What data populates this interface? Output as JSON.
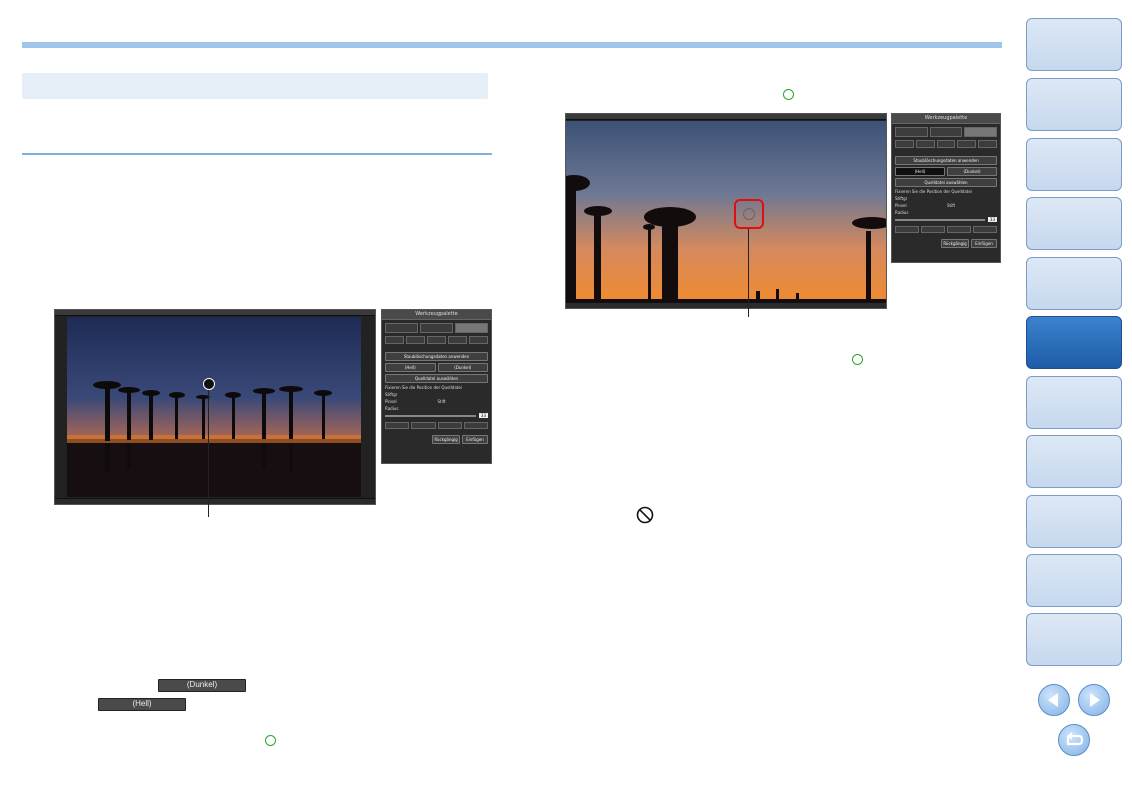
{
  "left_screenshot": {
    "palette": {
      "title": "Werkzeugpalette",
      "btn_apply": "Staublöschungsdaten anwenden",
      "btn_hell": "(Hell)",
      "btn_dunkel": "(Dunkel)",
      "btn_source": "Quelldatei auswählen",
      "fix_label": "Fixieren Sie die Position der Quelldatei",
      "shape_label": "Stiftgr",
      "shape_pinsel": "Pinsel",
      "shape_stift": "Stift",
      "radius_label": "Radius",
      "radius_value": "33",
      "btn_undo": "Rückgängig",
      "btn_einfuegen": "Einfügen"
    }
  },
  "right_screenshot": {
    "palette": {
      "title": "Werkzeugpalette",
      "btn_apply": "Staublöschungsdaten anwenden",
      "btn_hell": "(Hell)",
      "btn_dunkel": "(Dunkel)",
      "btn_source": "Quelldatei auswählen",
      "fix_label": "Fixieren Sie die Position der Quelldatei",
      "shape_label": "Stiftgr",
      "shape_pinsel": "Pinsel",
      "shape_stift": "Stift",
      "radius_label": "Radius",
      "radius_value": "33",
      "btn_undo": "Rückgängig",
      "btn_einfuegen": "Einfügen"
    }
  },
  "buttons": {
    "dunkel": "(Dunkel)",
    "hell": "(Hell)"
  },
  "colors": {
    "accent_blue": "#9fc6ea",
    "nav_active": "#1e5ca8",
    "mark_green": "#2aa52a",
    "callout_red": "#e01010"
  },
  "icons": {
    "prohibited": "prohibited-icon",
    "prev": "arrow-left-icon",
    "next": "arrow-right-icon",
    "return": "return-icon"
  }
}
